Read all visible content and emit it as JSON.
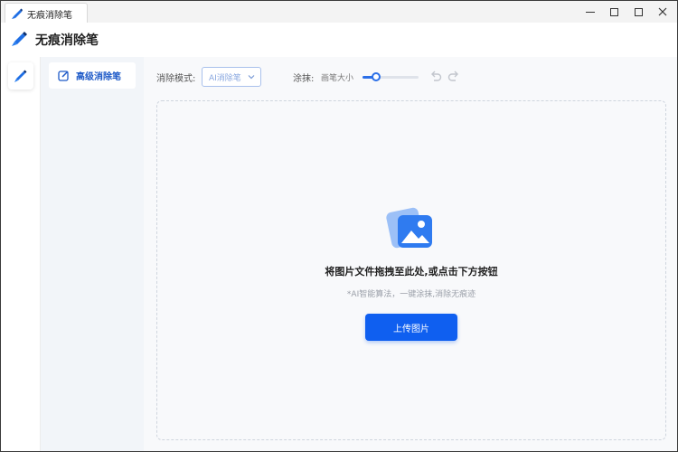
{
  "window": {
    "tab_title": "无痕消除笔",
    "controls": [
      "minimize",
      "maximize",
      "restore",
      "close"
    ]
  },
  "app": {
    "name": "无痕消除笔"
  },
  "nav": {
    "items": [
      {
        "label": "高级消除笔",
        "icon": "edit-icon",
        "active": true
      }
    ]
  },
  "toolbar": {
    "mode_label": "消除模式:",
    "mode_value": "AI消除笔",
    "smear_label": "涂抹:",
    "brush_size_label": "画笔大小",
    "brush_size_level": 0.2
  },
  "dropzone": {
    "title": "将图片文件拖拽至此处,或点击下方按钮",
    "subtitle": "*AI智能算法，一键涂抹,消除无痕迹",
    "upload_label": "上传图片"
  },
  "colors": {
    "accent": "#0f5ff0",
    "nav_active_text": "#1e5ac8",
    "nav_bg": "#f2f5f9"
  }
}
